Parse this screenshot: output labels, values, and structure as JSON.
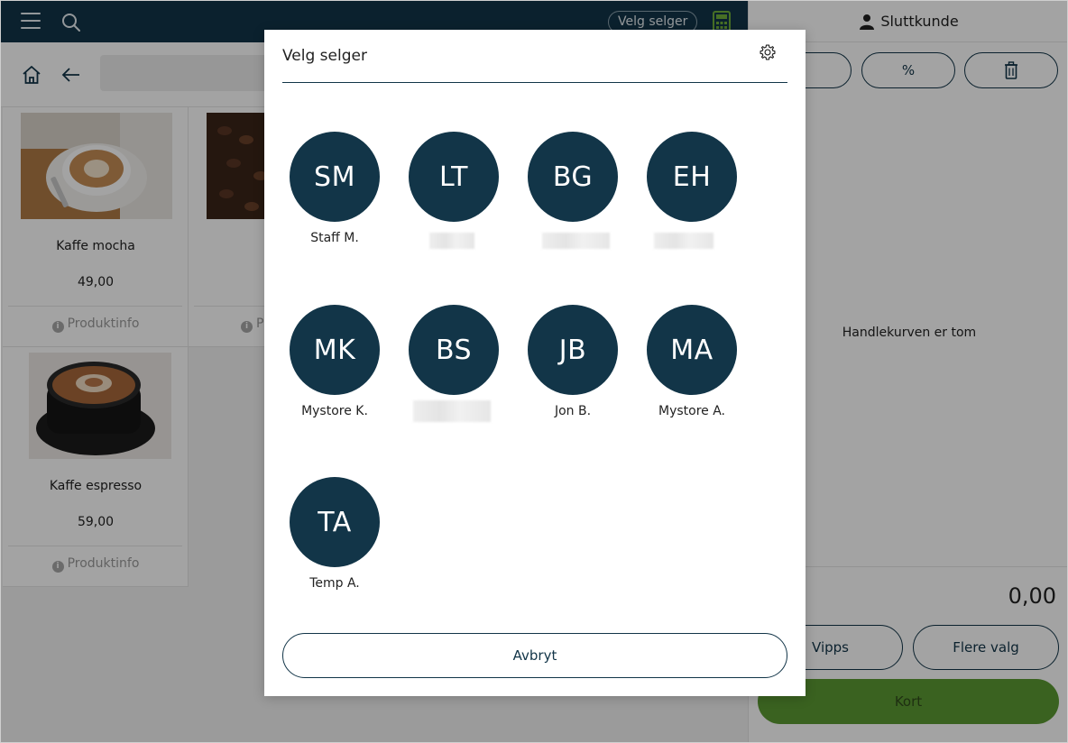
{
  "topbar": {
    "seller_chip": "Velg selger"
  },
  "products": [
    {
      "name": "Kaffe mocha",
      "price": "49,00",
      "info": "Produktinfo"
    },
    {
      "name": "",
      "price": "",
      "info": "P"
    },
    {
      "name": "Kaffe espresso",
      "price": "59,00",
      "info": "Produktinfo"
    }
  ],
  "cart": {
    "customer": "Sluttkunde",
    "empty_text": "Handlekurven er tom",
    "total": "0,00",
    "vipps_label": "Vipps",
    "more_label": "Flere valg",
    "card_label": "Kort",
    "action_minus": "−",
    "action_percent": "%"
  },
  "modal": {
    "title": "Velg selger",
    "cancel_label": "Avbryt",
    "sellers": [
      {
        "initials": "SM",
        "name": "Staff M."
      },
      {
        "initials": "LT",
        "name": ""
      },
      {
        "initials": "BG",
        "name": ""
      },
      {
        "initials": "EH",
        "name": ""
      },
      {
        "initials": "MK",
        "name": "Mystore K."
      },
      {
        "initials": "BS",
        "name": ""
      },
      {
        "initials": "JB",
        "name": "Jon B."
      },
      {
        "initials": "MA",
        "name": "Mystore A."
      },
      {
        "initials": "TA",
        "name": "Temp A."
      }
    ]
  },
  "colors": {
    "primary": "#123548",
    "card_green": "#5c9a32"
  }
}
